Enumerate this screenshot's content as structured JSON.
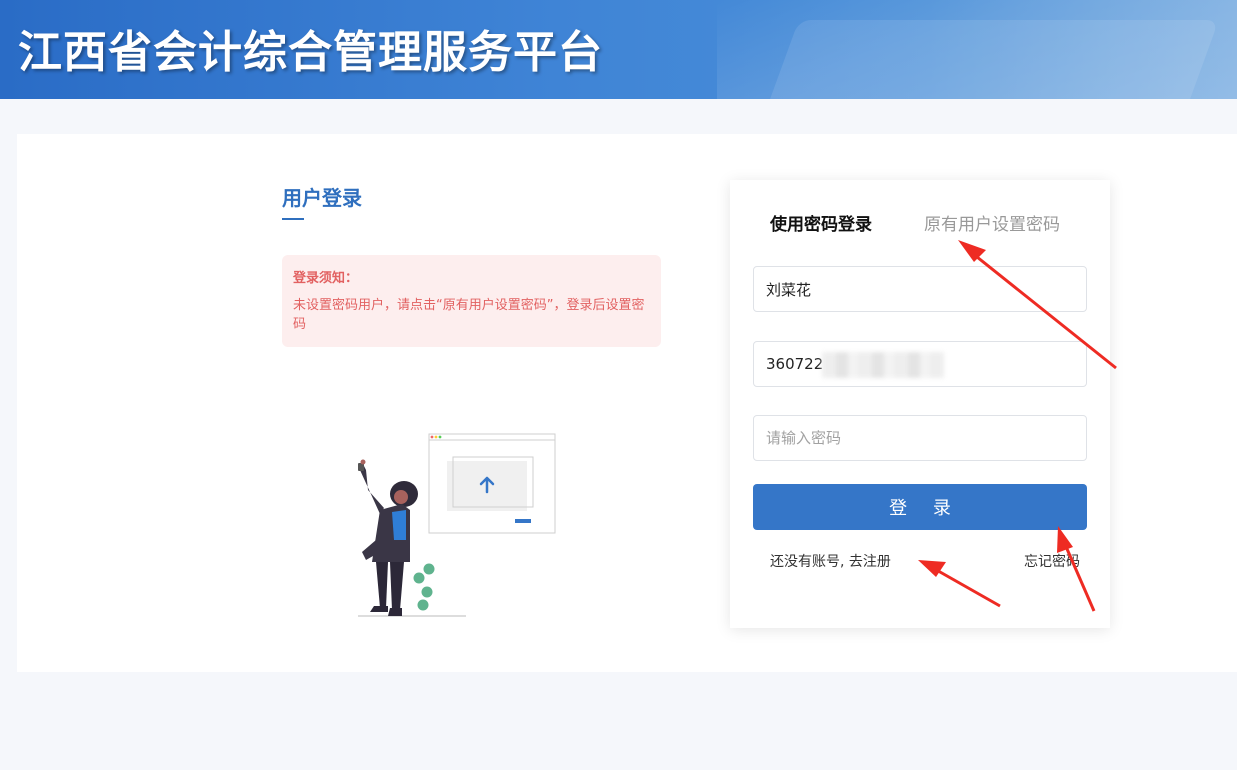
{
  "header": {
    "title": "江西省会计综合管理服务平台"
  },
  "left": {
    "title": "用户登录",
    "notice": {
      "title": "登录须知：",
      "text": "未设置密码用户，请点击“原有用户设置密码”，登录后设置密码"
    }
  },
  "login": {
    "tabs": [
      {
        "label": "使用密码登录",
        "active": true
      },
      {
        "label": "原有用户设置密码",
        "active": false
      }
    ],
    "username_value": "刘菜花",
    "id_value": "360722",
    "password_placeholder": "请输入密码",
    "submit_label": "登 录",
    "register_link": "还没有账号, 去注册",
    "forgot_link": "忘记密码"
  },
  "colors": {
    "brand": "#3576c8",
    "notice_text": "#e26161",
    "annotation_arrow": "#ee2b23"
  }
}
